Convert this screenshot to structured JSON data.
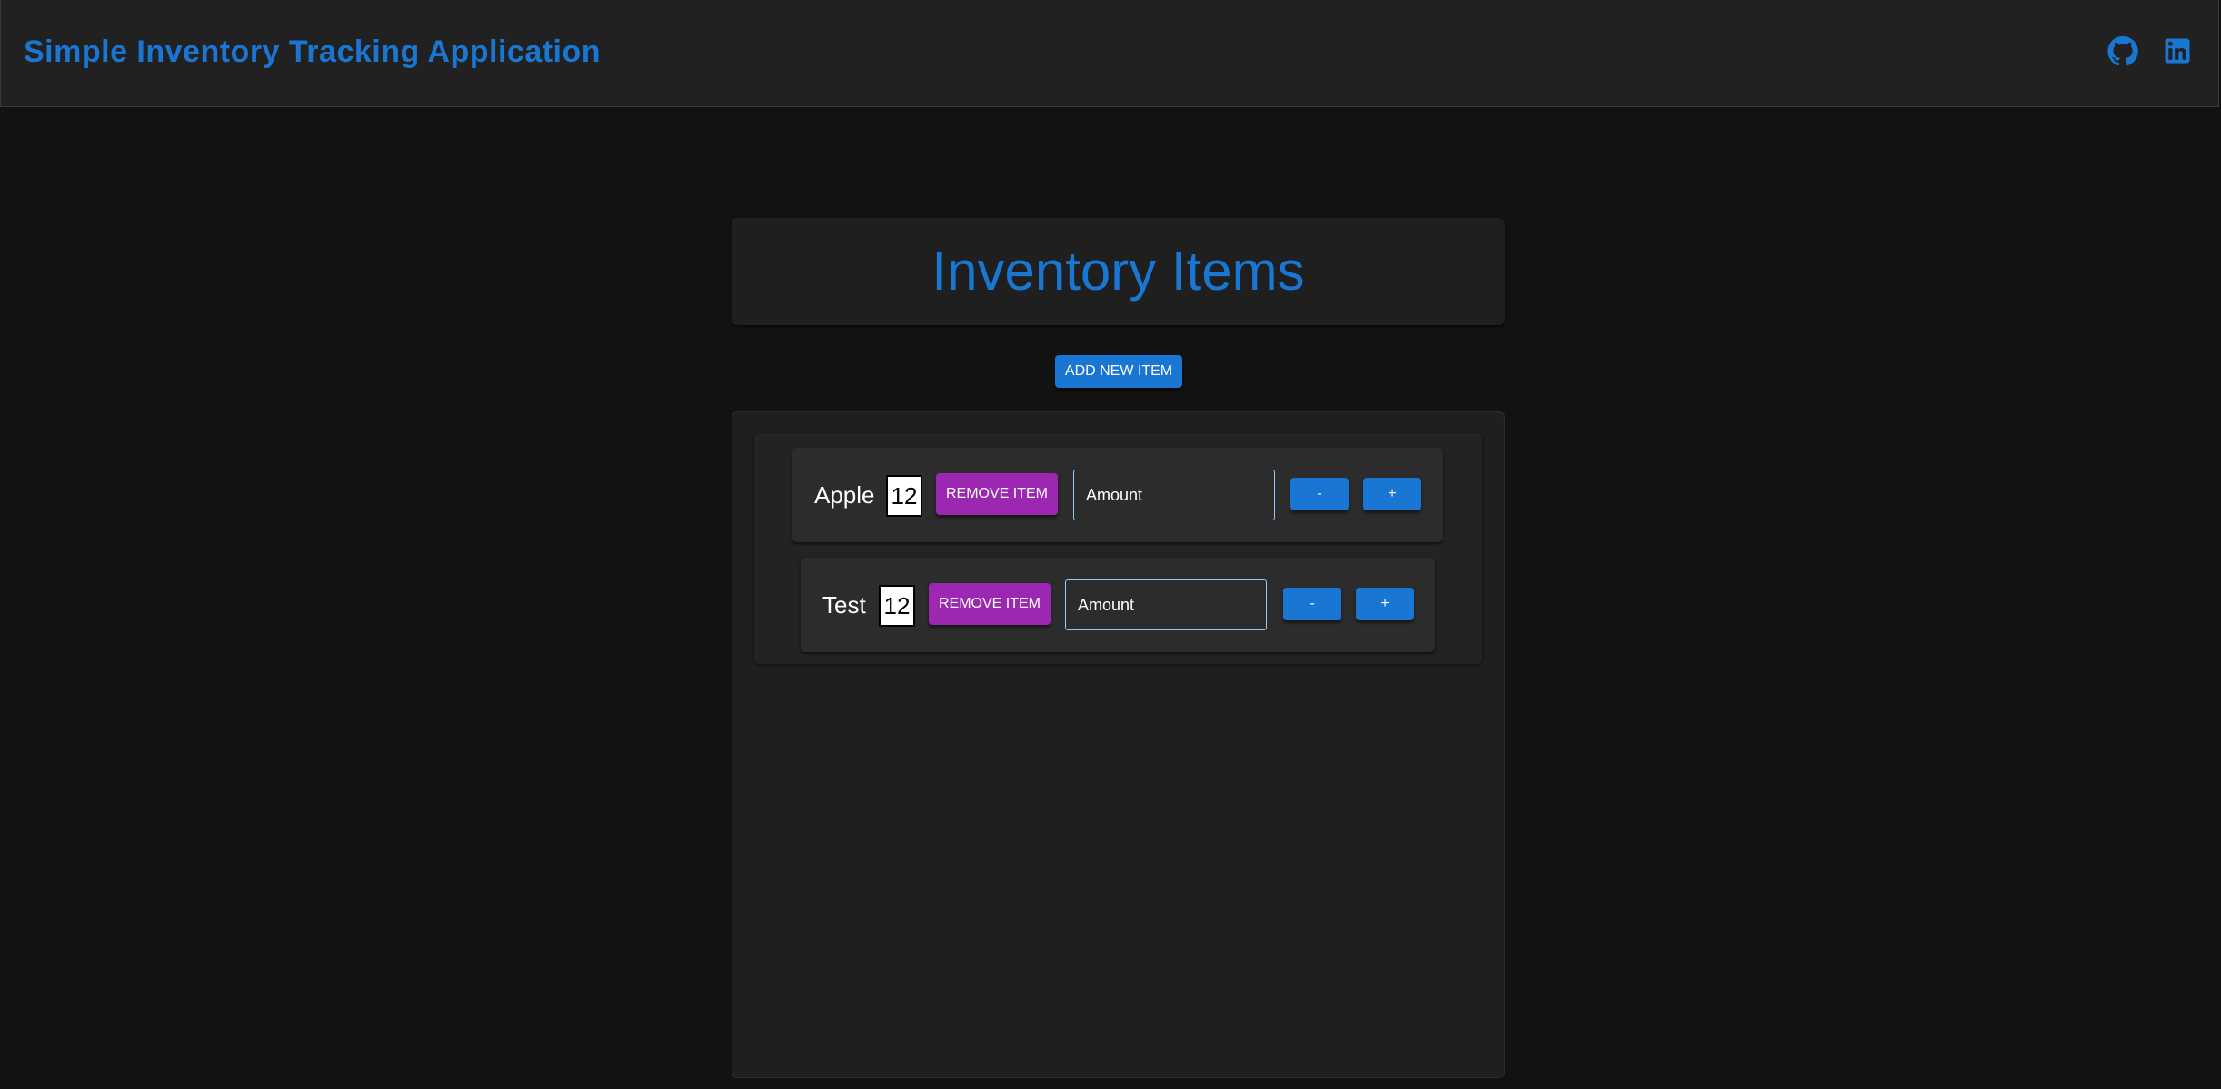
{
  "app": {
    "title": "Simple Inventory Tracking Application"
  },
  "header": {
    "github_icon": "github-icon",
    "linkedin_icon": "linkedin-icon"
  },
  "main": {
    "heading": "Inventory Items",
    "add_button_label": "ADD NEW ITEM"
  },
  "items": [
    {
      "name": "Apple",
      "quantity": "12",
      "remove_label": "REMOVE ITEM",
      "amount_placeholder": "Amount",
      "decrement_label": "-",
      "increment_label": "+"
    },
    {
      "name": "Test",
      "quantity": "12",
      "remove_label": "REMOVE ITEM",
      "amount_placeholder": "Amount",
      "decrement_label": "-",
      "increment_label": "+"
    }
  ],
  "colors": {
    "primary": "#1976d2",
    "secondary": "#9c27b0",
    "background": "#121212",
    "surface": "#1f1f1f",
    "input_border": "#90caf9"
  }
}
